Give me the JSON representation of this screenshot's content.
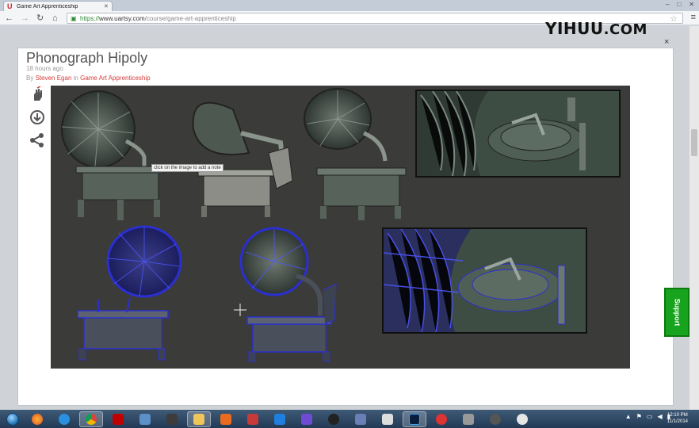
{
  "browser": {
    "tab_title": "Game Art Apprenticeship",
    "url_scheme": "https://",
    "url_host": "www.uartsy.com",
    "url_path": "/course/game-art-apprenticeship"
  },
  "watermark": {
    "brand": "YIHUU",
    "suffix": ".COM"
  },
  "modal": {
    "title": "Phonograph Hipoly",
    "timestamp": "18 hours ago",
    "byline_prefix": "By",
    "author": "Steven Egan",
    "byline_in": "in",
    "course": "Game Art Apprenticeship",
    "close_glyph": "×",
    "note_hint": "click on the image to add a note"
  },
  "support_label": "Support",
  "taskbar": {
    "time": "12:10 PM",
    "date": "11/1/2014"
  },
  "colors": {
    "accent": "#d73a3a",
    "support": "#18a31e",
    "canvas": "#3b3c3a"
  }
}
